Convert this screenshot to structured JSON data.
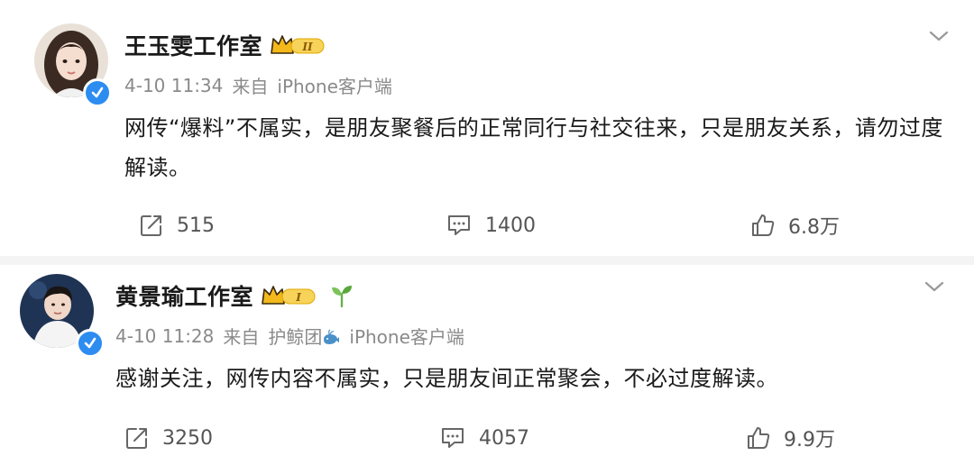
{
  "posts": [
    {
      "author": "王玉雯工作室",
      "badge_level": "II",
      "time": "4-10 11:34",
      "source_prefix": "来自",
      "client": "iPhone客户端",
      "content": "网传“爆料”不属实，是朋友聚餐后的正常同行与社交往来，只是朋友关系，请勿过度解读。",
      "reposts": "515",
      "comments": "1400",
      "likes": "6.8万"
    },
    {
      "author": "黄景瑜工作室",
      "badge_level": "I",
      "time": "4-10 11:28",
      "source_prefix": "来自",
      "client_prefix": "护鲸团",
      "client": "iPhone客户端",
      "content": "感谢关注，网传内容不属实，只是朋友间正常聚会，不必过度解读。",
      "reposts": "3250",
      "comments": "4057",
      "likes": "9.9万"
    }
  ],
  "icons": {
    "verified": "verified-badge-icon",
    "crown": "vip-crown-icon",
    "sprout": "sprout-icon",
    "whale": "whale-icon",
    "more": "chevron-down-icon",
    "repost": "repost-icon",
    "comment": "comment-icon",
    "like": "thumbs-up-icon"
  },
  "colors": {
    "verified_blue": "#2d8cf0",
    "crown_gold": "#f3b81c",
    "meta_gray": "#8a8a8a"
  }
}
